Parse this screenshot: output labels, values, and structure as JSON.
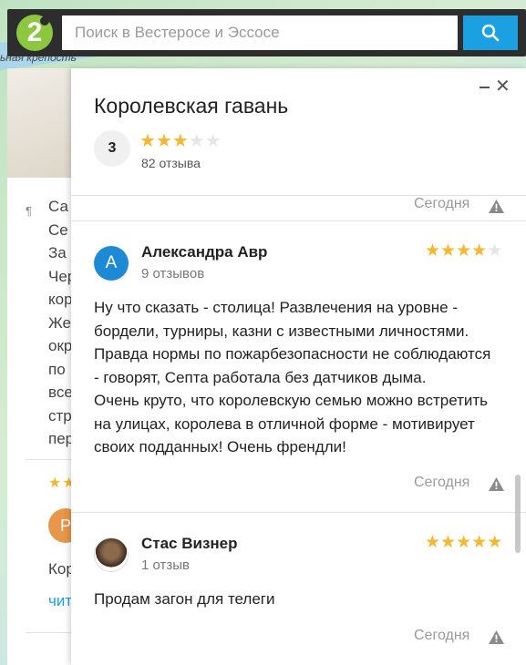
{
  "map": {
    "caption": "ьная крепость"
  },
  "search": {
    "placeholder": "Поиск в Вестеросе и Эссосе",
    "logo_text": "2"
  },
  "background_card": {
    "text_lines": [
      "Са",
      "Се",
      "За",
      "Чер",
      "кор",
      "Же",
      "окр",
      "по",
      "все",
      "стр",
      "пер"
    ],
    "avatar_letter": "Р",
    "word": "Кор",
    "link": "чит"
  },
  "place": {
    "title": "Королевская гавань",
    "rating": "3",
    "stars": 3,
    "reviews_count": "82 отзыва",
    "close": "✕"
  },
  "reviews": [
    {
      "author": "Александра Авр",
      "avatar_letter": "А",
      "count": "9 отзывов",
      "stars": 4,
      "text": "Ну что сказать - столица! Развлечения на уровне -\nбордели, турниры, казни с известными личностями.\nПравда нормы по пожарбезопасности не соблюдаются\n- говорят, Септа работала без датчиков дыма.\nОчень круто, что королевскую семью можно встретить\nна улицах, королева в отличной форме - мотивирует\nсвоих подданных! Очень френдли!",
      "date": "Сегодня"
    },
    {
      "author": "Стас Визнер",
      "avatar_letter": "",
      "count": "1 отзыв",
      "stars": 5,
      "text": "Продам загон для телеги",
      "date": "Сегодня"
    }
  ],
  "previous_review_date": "Сегодня",
  "colors": {
    "accent": "#1ba1e2",
    "star": "#f5b830",
    "logo": "#8dc63f",
    "topbar": "#2d2d2d"
  }
}
